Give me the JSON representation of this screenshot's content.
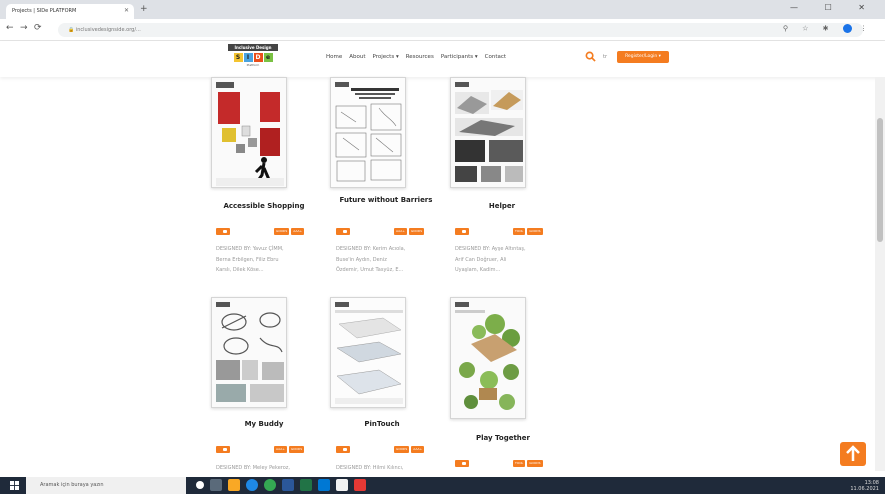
{
  "browser": {
    "tab_title": "Projects | SIDe PLATFORM",
    "url": "inclusivedesignside.org/...",
    "window_controls": "—  ☐  ✕"
  },
  "site": {
    "logo_top": "Inclusive Design",
    "logo_letters": [
      "S",
      "I",
      "D",
      "e"
    ],
    "logo_sub": "Platform",
    "nav": [
      "Home",
      "About",
      "Projects ▾",
      "Resources",
      "Participants ▾",
      "Contact"
    ],
    "lang": "tr",
    "register_label": "Register/Login ▾"
  },
  "cards": [
    {
      "title": "Accessible Shopping",
      "tags": [
        "GOODS",
        "AAA+"
      ],
      "designed": [
        "DESIGNED BY: Yavuz ÇİMM,",
        "Berna Erbilgen, Filiz Ebru",
        "Karslı, Dilek Köse..."
      ]
    },
    {
      "title": "Future without Barriers",
      "tags": [
        "AAA+",
        "GOODS"
      ],
      "designed": [
        "DESIGNED BY: Kerim Acıola,",
        "Buse'in Aydın, Deniz",
        "Özdemir, Umut Tasyüz, E..."
      ]
    },
    {
      "title": "Helper",
      "tags": [
        "TOOL",
        "GOODS"
      ],
      "designed": [
        "DESIGNED BY: Ayşe Altıntaş,",
        "Arif Can Doğruer, Ali",
        "Uyaşlam, Kadim..."
      ]
    },
    {
      "title": "My Buddy",
      "tags": [
        "AAA+",
        "GOODS"
      ],
      "designed": [
        "DESIGNED BY: Meley Pekeroz,"
      ]
    },
    {
      "title": "PinTouch",
      "tags": [
        "GOODS",
        "AAA+"
      ],
      "designed": [
        "DESIGNED BY: Hilmi Kılıncı,"
      ]
    },
    {
      "title": "Play Together",
      "tags": [
        "TOOL",
        "GOODS"
      ],
      "designed": []
    }
  ],
  "back_to_top": "↑",
  "taskbar": {
    "search_placeholder": "Aramak için buraya yazın",
    "time": "13:08",
    "date": "11.06.2021"
  },
  "colors": {
    "accent": "#f47c20",
    "taskbar": "#1f2a3a"
  }
}
